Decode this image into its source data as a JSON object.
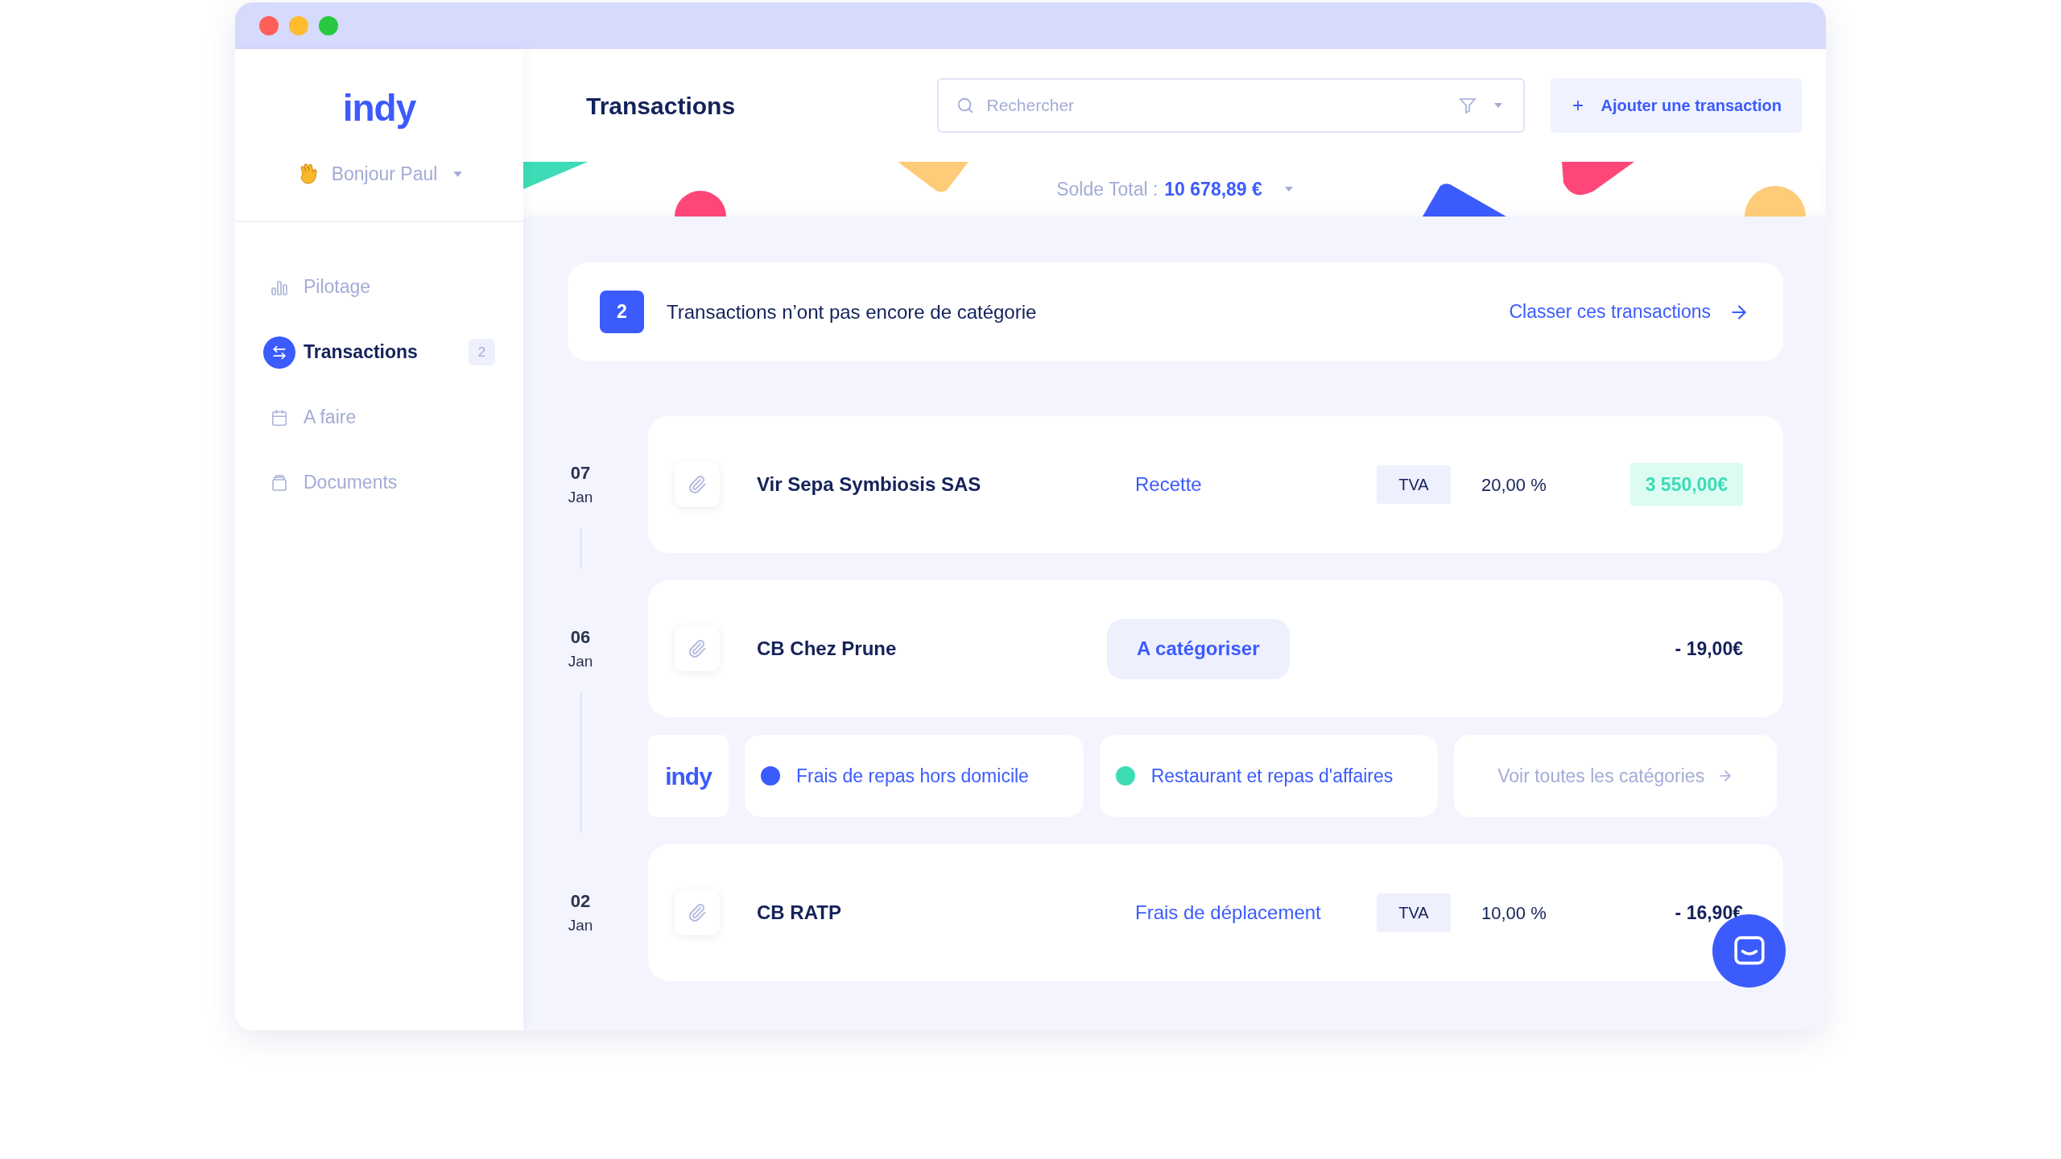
{
  "sidebar": {
    "logo": "indy",
    "greeting": "Bonjour Paul",
    "nav": [
      {
        "label": "Pilotage",
        "kind": "chart",
        "selected": false
      },
      {
        "label": "Transactions",
        "kind": "transfer",
        "selected": true,
        "badge": "2"
      },
      {
        "label": "A faire",
        "kind": "calendar",
        "selected": false
      },
      {
        "label": "Documents",
        "kind": "document",
        "selected": false
      }
    ]
  },
  "header": {
    "title": "Transactions",
    "search": {
      "placeholder": "Rechercher"
    },
    "add_button": "Ajouter une transaction"
  },
  "balance": {
    "label": "Solde Total :",
    "value": "10 678,89 €"
  },
  "alert": {
    "count": "2",
    "text": "Transactions n’ont pas encore de catégorie",
    "link": "Classer ces transactions"
  },
  "transactions": [
    {
      "day": "07",
      "month": "Jan",
      "name": "Vir Sepa Symbiosis SAS",
      "category": {
        "kind": "link",
        "label": "Recette"
      },
      "tax_label": "TVA",
      "tax_rate": "20,00 %",
      "amount": {
        "kind": "income",
        "value": "3 550,00€"
      }
    },
    {
      "day": "06",
      "month": "Jan",
      "name": "CB Chez Prune",
      "category": {
        "kind": "pending",
        "label": "A catégoriser"
      },
      "amount": {
        "kind": "expense",
        "value": "- 19,00€"
      },
      "suggestions": {
        "logo": "indy",
        "items": [
          {
            "label": "Frais de repas hors domicile",
            "color": "#3b5bfd"
          },
          {
            "label": "Restaurant et repas d'affaires",
            "color": "#3ddbb6"
          }
        ],
        "more": "Voir toutes les catégories"
      }
    },
    {
      "day": "02",
      "month": "Jan",
      "name": "CB RATP",
      "category": {
        "kind": "link",
        "label": "Frais de déplacement"
      },
      "tax_label": "TVA",
      "tax_rate": "10,00 %",
      "amount": {
        "kind": "expense",
        "value": "- 16,90€"
      }
    }
  ]
}
